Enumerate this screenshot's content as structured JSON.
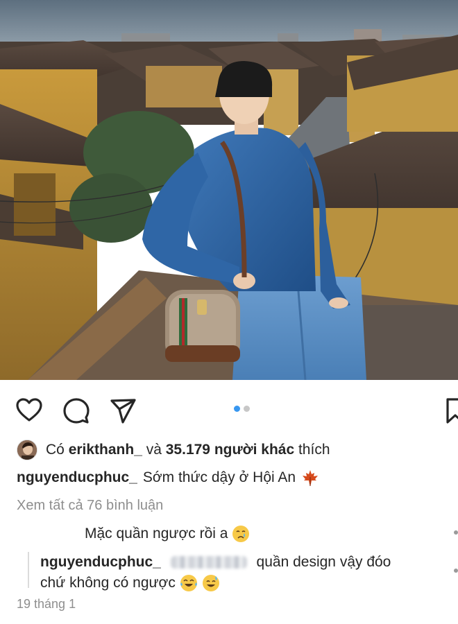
{
  "post": {
    "carousel": {
      "count": 2,
      "active_index": 0
    },
    "likes": {
      "prefix": "Có ",
      "user": "erikthanh_",
      "middle": " và ",
      "count": "35.179 người khác",
      "suffix": " thích"
    },
    "caption": {
      "username": "nguyenducphuc_",
      "text": "Sớm thức dậy ở Hội An"
    },
    "view_all_comments": "Xem tất cả 76 bình luận",
    "comments": [
      {
        "text": "Mặc quần ngược rồi a"
      }
    ],
    "reply": {
      "username": "nguyenducphuc_",
      "text_line1": "quần design vậy đóo",
      "text_line2": "chứ không có ngược"
    },
    "date": "19 tháng 1"
  },
  "icons": {
    "like": "heart-icon",
    "comment": "comment-icon",
    "share": "send-icon",
    "save": "bookmark-icon",
    "caption_emoji": "maple-leaf-icon",
    "comment_emoji": "crying-face-icon",
    "reply_emojis": [
      "tears-of-joy-icon",
      "sweat-smile-icon"
    ]
  },
  "colors": {
    "text": "#262626",
    "muted": "#8e8e8e",
    "carousel_active": "#3897f0",
    "carousel_inactive": "#c7c7c7"
  }
}
